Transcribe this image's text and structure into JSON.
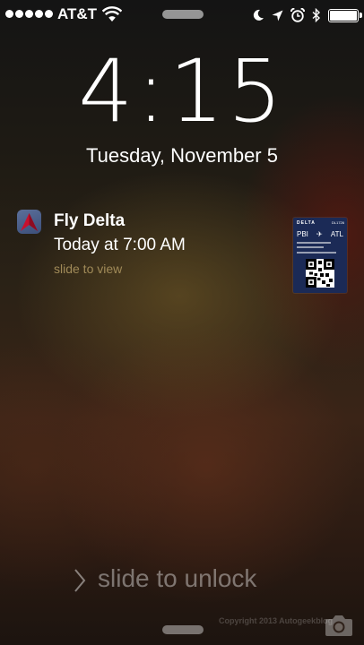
{
  "status_bar": {
    "signal_bars": 5,
    "carrier": "AT&T",
    "icons": [
      "wifi-icon",
      "moon-icon",
      "location-arrow-icon",
      "alarm-clock-icon",
      "bluetooth-icon",
      "battery-icon"
    ],
    "battery_level": 1.0
  },
  "lock_screen": {
    "time": "4:15",
    "date": "Tuesday, November 5"
  },
  "notification": {
    "app_icon": "delta-logo-icon",
    "title": "Fly Delta",
    "body": "Today at 7:00 AM",
    "action": "slide to view",
    "attachment": {
      "type": "boarding-pass-thumbnail",
      "brand": "DELTA",
      "flight": "DL1726",
      "origin": "PBI",
      "destination": "ATL"
    }
  },
  "unlock": {
    "label": "slide to unlock",
    "icon": "chevron-right-icon"
  },
  "watermark": "Copyright 2013 Autogeekblog",
  "camera": {
    "icon": "camera-icon"
  }
}
